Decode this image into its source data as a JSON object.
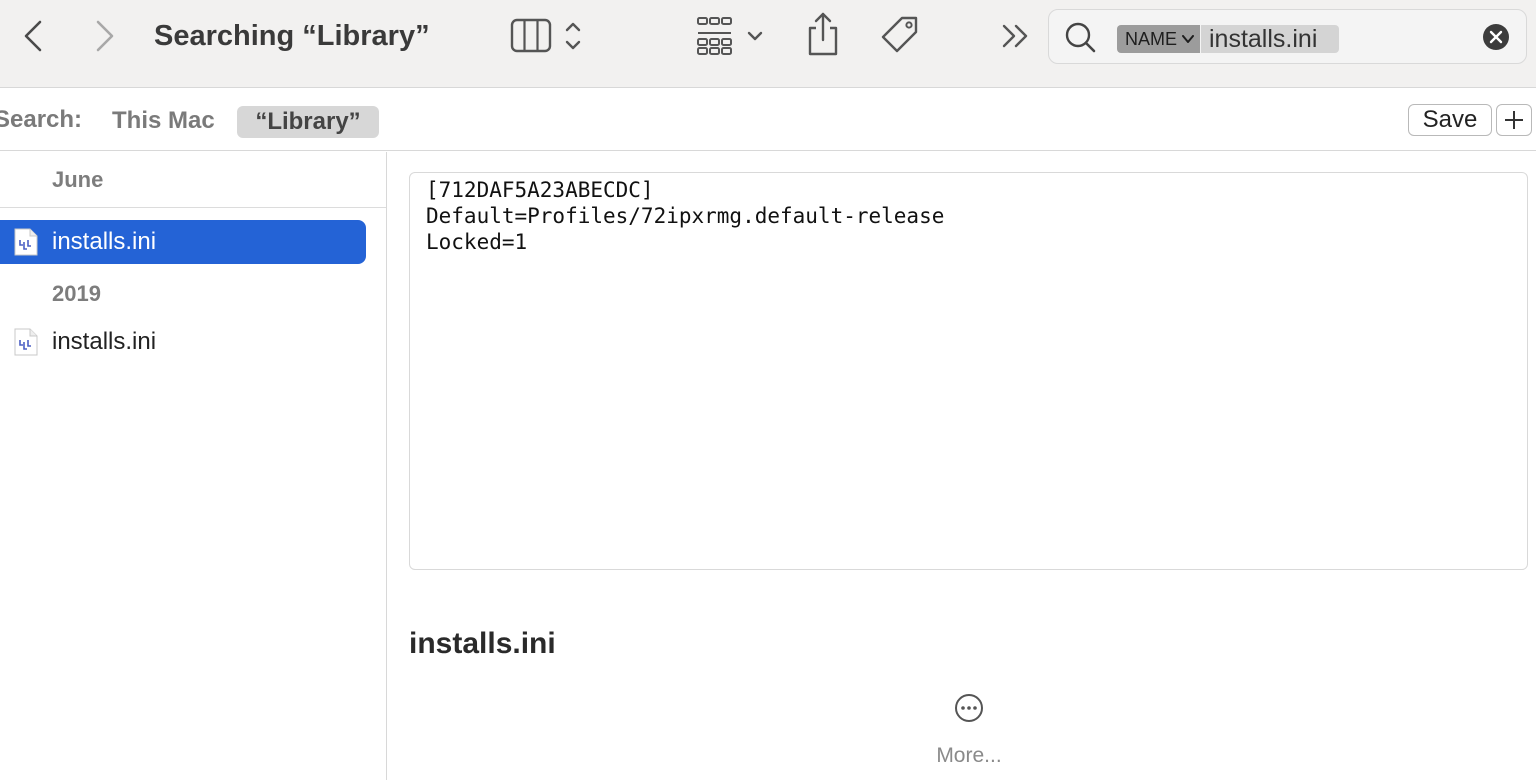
{
  "toolbar": {
    "title": "Searching “Library”"
  },
  "search": {
    "token_kind": "NAME",
    "token_value": "installs.ini"
  },
  "scope": {
    "label": "Search:",
    "this_mac": "This Mac",
    "library": "“Library”",
    "save_label": "Save",
    "add_label": "+"
  },
  "list": {
    "groups": [
      {
        "header": "June",
        "items": [
          {
            "name": "installs.ini",
            "selected": true
          }
        ]
      },
      {
        "header": "2019",
        "items": [
          {
            "name": "installs.ini",
            "selected": false
          }
        ]
      }
    ]
  },
  "preview": {
    "lines": [
      "[712DAF5A23ABECDC]",
      "Default=Profiles/72ipxrmg.default-release",
      "Locked=1"
    ],
    "filename": "installs.ini",
    "more_label": "More..."
  },
  "colors": {
    "selection": "#2463d6",
    "toolbar_bg": "#f2f1f0"
  }
}
